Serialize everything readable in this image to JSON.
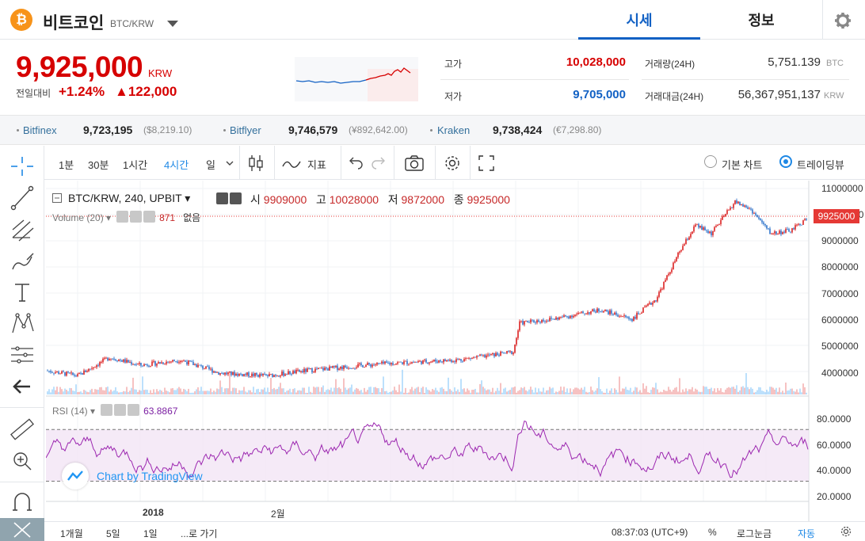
{
  "header": {
    "coin_symbol": "₿",
    "coin_name": "비트코인",
    "pair": "BTC/KRW",
    "tabs": [
      {
        "label": "시세"
      },
      {
        "label": "정보"
      }
    ]
  },
  "ticker": {
    "price": "9,925,000",
    "unit": "KRW",
    "change_label": "전일대비",
    "change_pct": "+1.24%",
    "change_val": "▲122,000",
    "high_label": "고가",
    "high": "10,028,000",
    "low_label": "저가",
    "low": "9,705,000",
    "vol_label": "거래량(24H)",
    "vol": "5,751.139",
    "vol_unit": "BTC",
    "amt_label": "거래대금(24H)",
    "amt": "56,367,951,137",
    "amt_unit": "KRW"
  },
  "exchanges": [
    {
      "name": "Bitfinex",
      "price": "9,723,195",
      "fx": "($8,219.10)"
    },
    {
      "name": "Bitflyer",
      "price": "9,746,579",
      "fx": "(¥892,642.00)"
    },
    {
      "name": "Kraken",
      "price": "9,738,424",
      "fx": "(€7,298.80)"
    }
  ],
  "toolbar": {
    "intervals": [
      {
        "label": "1분"
      },
      {
        "label": "30분"
      },
      {
        "label": "1시간"
      },
      {
        "label": "4시간"
      },
      {
        "label": "일"
      }
    ],
    "indicator_label": "지표",
    "basic_chart": "기본 차트",
    "trading_view": "트레이딩뷰"
  },
  "legend": {
    "symbol": "BTC/KRW, 240, UPBIT",
    "open_label": "시",
    "open": "9909000",
    "high_label": "고",
    "high": "10028000",
    "low_label": "저",
    "low": "9872000",
    "close_label": "종",
    "close": "9925000",
    "volume_label": "Volume (20)",
    "volume_val": "871",
    "volume_ma": "없음",
    "rsi_label": "RSI (14)",
    "rsi_val": "63.8867"
  },
  "price_axis": [
    "11000000",
    "10000000",
    "9000000",
    "8000000",
    "7000000",
    "6000000",
    "5000000",
    "4000000"
  ],
  "price_tag": "9925000",
  "rsi_axis": [
    "80.0000",
    "60.0000",
    "40.0000",
    "20.0000"
  ],
  "time_axis": [
    "2018",
    "2월"
  ],
  "watermark": "Chart by TradingView",
  "bottom": {
    "ranges": [
      {
        "label": "1개월"
      },
      {
        "label": "5일"
      },
      {
        "label": "1일"
      },
      {
        "label": "...로 가기"
      }
    ],
    "time": "08:37:03 (UTC+9)",
    "pct": "%",
    "log": "로그눈금",
    "auto": "자동"
  },
  "colors": {
    "up": "#d60000",
    "down": "#1261c4",
    "accent": "#1e88e5",
    "rsi": "#9c27b0"
  }
}
